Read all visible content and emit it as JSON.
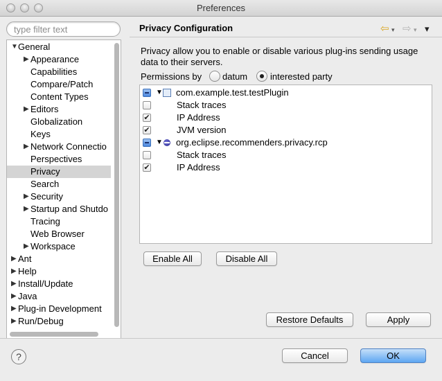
{
  "window": {
    "title": "Preferences"
  },
  "filter": {
    "placeholder": "type filter text"
  },
  "tree": [
    {
      "label": "General",
      "level": 0,
      "twisty": "expanded"
    },
    {
      "label": "Appearance",
      "level": 1,
      "twisty": "collapsed"
    },
    {
      "label": "Capabilities",
      "level": 1,
      "twisty": "none"
    },
    {
      "label": "Compare/Patch",
      "level": 1,
      "twisty": "none"
    },
    {
      "label": "Content Types",
      "level": 1,
      "twisty": "none"
    },
    {
      "label": "Editors",
      "level": 1,
      "twisty": "collapsed"
    },
    {
      "label": "Globalization",
      "level": 1,
      "twisty": "none"
    },
    {
      "label": "Keys",
      "level": 1,
      "twisty": "none"
    },
    {
      "label": "Network Connectio",
      "level": 1,
      "twisty": "collapsed"
    },
    {
      "label": "Perspectives",
      "level": 1,
      "twisty": "none"
    },
    {
      "label": "Privacy",
      "level": 1,
      "twisty": "none",
      "selected": true
    },
    {
      "label": "Search",
      "level": 1,
      "twisty": "none"
    },
    {
      "label": "Security",
      "level": 1,
      "twisty": "collapsed"
    },
    {
      "label": "Startup and Shutdo",
      "level": 1,
      "twisty": "collapsed"
    },
    {
      "label": "Tracing",
      "level": 1,
      "twisty": "none"
    },
    {
      "label": "Web Browser",
      "level": 1,
      "twisty": "none"
    },
    {
      "label": "Workspace",
      "level": 1,
      "twisty": "collapsed"
    },
    {
      "label": "Ant",
      "level": 0,
      "twisty": "collapsed"
    },
    {
      "label": "Help",
      "level": 0,
      "twisty": "collapsed"
    },
    {
      "label": "Install/Update",
      "level": 0,
      "twisty": "collapsed"
    },
    {
      "label": "Java",
      "level": 0,
      "twisty": "collapsed"
    },
    {
      "label": "Plug-in Development",
      "level": 0,
      "twisty": "collapsed"
    },
    {
      "label": "Run/Debug",
      "level": 0,
      "twisty": "collapsed"
    }
  ],
  "page": {
    "title": "Privacy Configuration",
    "description": "Privacy allow you to enable or disable various plug-ins sending usage data to their servers.",
    "permissions_label": "Permissions by",
    "radio_datum": "datum",
    "radio_interested": "interested party",
    "selected_radio": "interested party"
  },
  "permissions": [
    {
      "type": "group",
      "icon": "plugin-icon",
      "label": "com.example.test.testPlugin",
      "state": "partial"
    },
    {
      "type": "item",
      "label": "Stack traces",
      "checked": false
    },
    {
      "type": "item",
      "label": "IP Address",
      "checked": true
    },
    {
      "type": "item",
      "label": "JVM version",
      "checked": true
    },
    {
      "type": "group",
      "icon": "eclipse-icon",
      "label": "org.eclipse.recommenders.privacy.rcp",
      "state": "partial"
    },
    {
      "type": "item",
      "label": "Stack traces",
      "checked": false
    },
    {
      "type": "item",
      "label": "IP Address",
      "checked": true
    }
  ],
  "buttons": {
    "enable_all": "Enable All",
    "disable_all": "Disable All",
    "restore_defaults": "Restore Defaults",
    "apply": "Apply",
    "cancel": "Cancel",
    "ok": "OK"
  },
  "icons": {
    "help": "?",
    "back": "⇦",
    "forward": "⇨",
    "menu": "▾"
  }
}
